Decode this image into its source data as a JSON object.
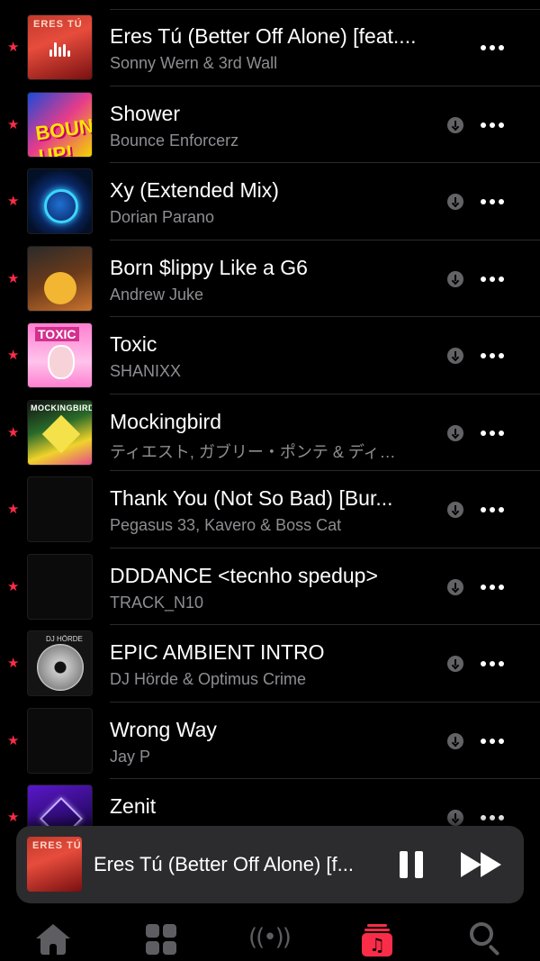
{
  "tracks": [
    {
      "title": "Eres Tú (Better Off Alone) [feat....",
      "artist": "Sonny Wern & 3rd Wall",
      "art_text": "ERES TÚ"
    },
    {
      "title": "Shower",
      "artist": "Bounce Enforcerz",
      "art_text": "BOUNCE UP!"
    },
    {
      "title": "Xy (Extended Mix)",
      "artist": "Dorian Parano",
      "art_text": ""
    },
    {
      "title": "Born $lippy Like a G6",
      "artist": "Andrew Juke",
      "art_text": ""
    },
    {
      "title": "Toxic",
      "artist": "SHANIXX",
      "art_text": "TOXIC"
    },
    {
      "title": "Mockingbird",
      "artist": "ティエスト, ガブリー・ポンテ & ディ…",
      "art_text": "MOCKINGBIRD"
    },
    {
      "title": "Thank You (Not So Bad) [Bur...",
      "artist": "Pegasus 33, Kavero & Boss Cat",
      "art_text": ""
    },
    {
      "title": "DDDANCE <tecnho spedup>",
      "artist": "TRACK_N10",
      "art_text": ""
    },
    {
      "title": "EPIC AMBIENT INTRO",
      "artist": "DJ Hörde & Optimus Crime",
      "art_text": "DJ HÖRDE"
    },
    {
      "title": "Wrong Way",
      "artist": "Jay P",
      "art_text": ""
    },
    {
      "title": "Zenit",
      "artist": "",
      "art_text": ""
    }
  ],
  "mini_player": {
    "title": "Eres Tú (Better Off Alone) [f...",
    "art_text": "ERES TÚ",
    "state": "playing"
  },
  "icons": {
    "favorite": "★",
    "more": "more-icon",
    "download": "download-icon",
    "radio": "((•))",
    "library_note": "♫"
  },
  "colors": {
    "accent": "#fa2d48",
    "background": "#000000",
    "secondary_text": "#8e8e93",
    "inactive_tab": "#5e5e62",
    "player_bg": "#2c2c2e"
  },
  "tabs": [
    {
      "name": "home",
      "active": false
    },
    {
      "name": "browse",
      "active": false
    },
    {
      "name": "radio",
      "active": false
    },
    {
      "name": "library",
      "active": true
    },
    {
      "name": "search",
      "active": false
    }
  ]
}
